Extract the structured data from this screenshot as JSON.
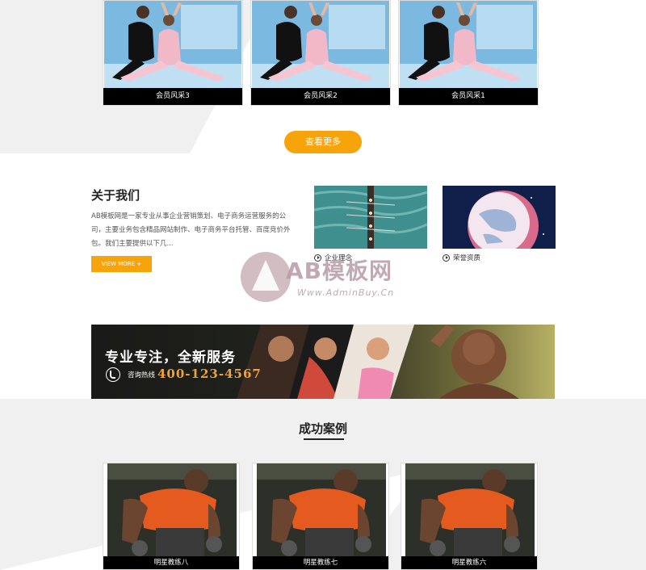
{
  "gallery": {
    "items": [
      {
        "caption": "会员风采3"
      },
      {
        "caption": "会员风采2"
      },
      {
        "caption": "会员风采1"
      }
    ],
    "more_button": "查看更多"
  },
  "about": {
    "title": "关于我们",
    "text": "AB模板网是一家专业从事企业营销策划、电子商务运营服务的公司，主要业务包含精品网站制作、电子商务平台托管、百度竞价外包。我们主要提供以下几...",
    "view_more": "VIEW MORE +",
    "features": [
      {
        "label": "企业理念"
      },
      {
        "label": "荣誉资质"
      }
    ]
  },
  "watermark": {
    "brand": "AB模板网",
    "url": "Www.AdminBuy.Cn"
  },
  "banner": {
    "title": "专业专注，全新服务",
    "hotline_label": "咨询热线",
    "phone": "400-123-4567"
  },
  "cases": {
    "title": "成功案例",
    "items": [
      {
        "caption": "明星教练八"
      },
      {
        "caption": "明星教练七"
      },
      {
        "caption": "明星教练六"
      }
    ]
  },
  "colors": {
    "accent": "#f7a30a",
    "caption_bg": "#000000",
    "phone": "#f0a23a"
  }
}
